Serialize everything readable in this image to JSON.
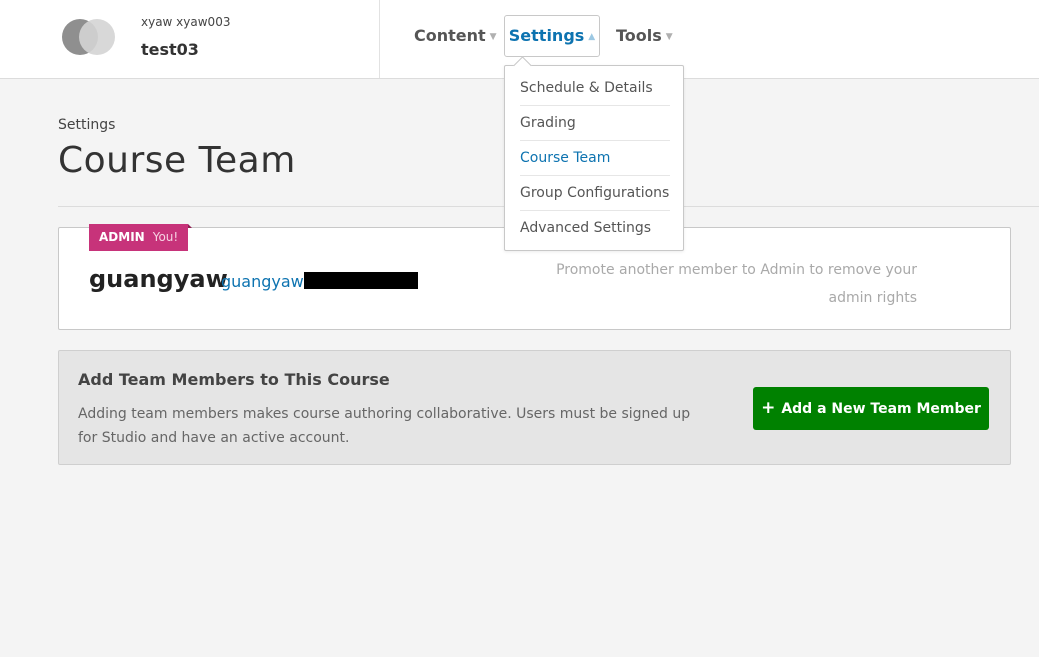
{
  "course": {
    "org": "xyaw  xyaw003",
    "name": "test03"
  },
  "nav": {
    "content": "Content",
    "settings": "Settings",
    "tools": "Tools",
    "caret_down": "▼",
    "caret_up": "▲"
  },
  "dropdown": {
    "items": [
      {
        "label": "Schedule & Details"
      },
      {
        "label": "Grading"
      },
      {
        "label": "Course Team"
      },
      {
        "label": "Group Configurations"
      },
      {
        "label": "Advanced Settings"
      }
    ],
    "active_item": "Course Team"
  },
  "page": {
    "section": "Settings",
    "title": "Course Team"
  },
  "member": {
    "role": "ADMIN",
    "you": "You!",
    "username": "guangyaw",
    "email_prefix": "guangyaw",
    "note": "Promote another member to Admin to remove your admin rights"
  },
  "add_panel": {
    "title": "Add Team Members to This Course",
    "description": "Adding team members makes course authoring collaborative. Users must be signed up for Studio and have an active account.",
    "button_label": "Add a New Team Member",
    "button_icon": "+"
  },
  "colors": {
    "link_blue": "#0d73b0",
    "admin_flag": "#c7337a",
    "add_button_green": "#008100",
    "background": "#f4f4f4"
  }
}
